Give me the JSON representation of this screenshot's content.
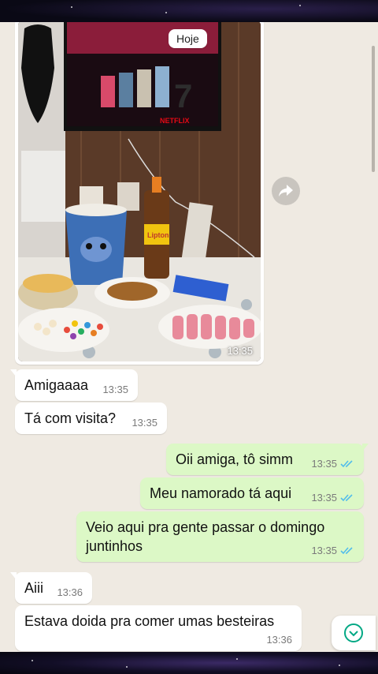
{
  "chat": {
    "date_label": "Hoje",
    "photo": {
      "time": "13:35",
      "tv_brand": "NETFLIX",
      "bottle_brand": "Lipton"
    },
    "messages": [
      {
        "dir": "in",
        "text": "Amigaaaa",
        "time": "13:35"
      },
      {
        "dir": "in",
        "text": "Tá com visita?",
        "time": "13:35"
      },
      {
        "dir": "out",
        "text": "Oii amiga, tô simm",
        "time": "13:35"
      },
      {
        "dir": "out",
        "text": "Meu namorado tá aqui",
        "time": "13:35"
      },
      {
        "dir": "out",
        "text": "Veio aqui pra gente passar o domingo juntinhos",
        "time": "13:35"
      },
      {
        "dir": "in",
        "text": "Aiii",
        "time": "13:36"
      },
      {
        "dir": "in",
        "text": "Estava doida pra comer umas besteiras",
        "time": "13:36"
      }
    ]
  },
  "colors": {
    "chat_background": "#efeae2",
    "incoming_bubble": "#ffffff",
    "outgoing_bubble": "#dcf8c6",
    "read_ticks": "#53bdeb",
    "accent": "#00a884"
  },
  "icons": {
    "read_receipt": "double-check-icon",
    "forward": "forward-arrow-icon",
    "scroll_down": "chevron-down-circle-icon"
  }
}
